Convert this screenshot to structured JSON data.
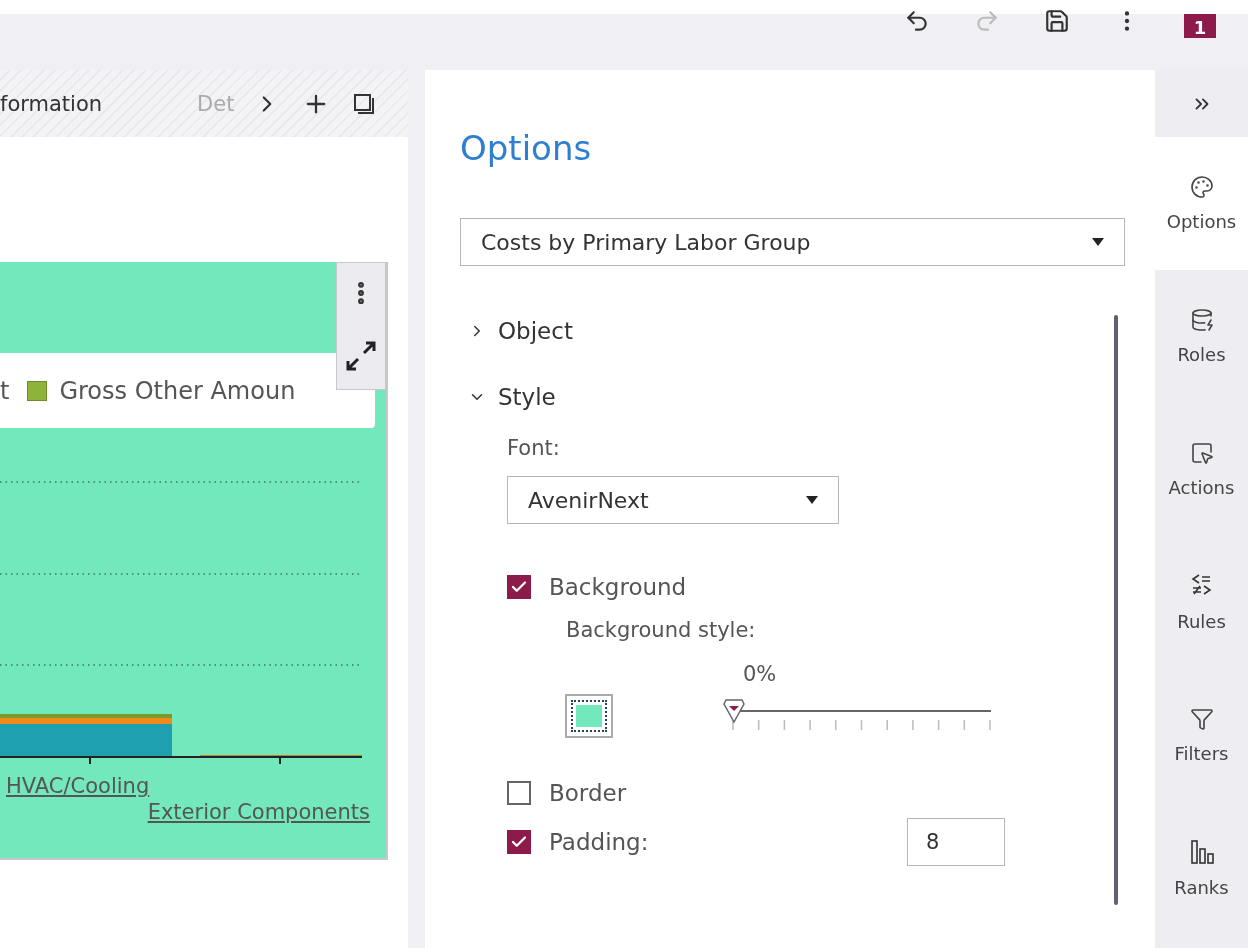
{
  "toolbar": {
    "undo_disabled": false,
    "redo_disabled": true,
    "user_badge": "1"
  },
  "tabs": [
    {
      "label": "formation",
      "selected": true
    },
    {
      "label": "Det",
      "selected": false
    }
  ],
  "chart": {
    "legend": [
      {
        "label": "t"
      },
      {
        "label": "Gross Other Amoun",
        "color": "#8db33a"
      }
    ],
    "categories": [
      "HVAC/Cooling",
      "Exterior Components"
    ]
  },
  "options": {
    "title": "Options",
    "object_select": "Costs by Primary Labor Group",
    "sections": [
      {
        "label": "Object",
        "expanded": false
      },
      {
        "label": "Style",
        "expanded": true
      }
    ],
    "font_label": "Font:",
    "font_value": "AvenirNext",
    "background": {
      "label": "Background",
      "checked": true
    },
    "background_style_label": "Background style:",
    "transparency": {
      "reading": "0%",
      "level": 0
    },
    "border": {
      "label": "Border",
      "checked": false
    },
    "padding": {
      "label": "Padding:",
      "checked": true,
      "value": "8"
    }
  },
  "sidebar": {
    "items": [
      {
        "kind": "options",
        "label": "Options",
        "selected": true
      },
      {
        "kind": "roles",
        "label": "Roles",
        "selected": false
      },
      {
        "kind": "actions",
        "label": "Actions",
        "selected": false
      },
      {
        "kind": "rules",
        "label": "Rules",
        "selected": false
      },
      {
        "kind": "filters",
        "label": "Filters",
        "selected": false
      },
      {
        "kind": "ranks",
        "label": "Ranks",
        "selected": false
      }
    ]
  }
}
